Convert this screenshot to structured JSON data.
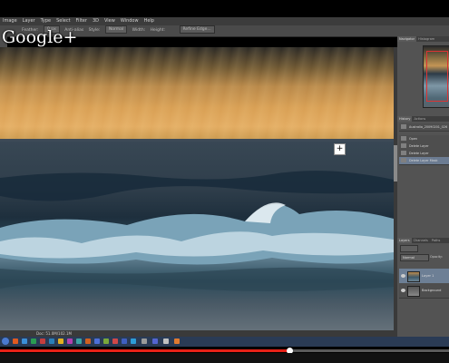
{
  "overlay": {
    "watermark": "Google+"
  },
  "menu": [
    "Image",
    "Layer",
    "Type",
    "Select",
    "Filter",
    "3D",
    "View",
    "Window",
    "Help"
  ],
  "options_bar": {
    "feather_label": "Feather:",
    "feather_value": "0 px",
    "antialias_label": "Anti-alias",
    "style_label": "Style:",
    "style_value": "Normal",
    "width_label": "Width:",
    "height_label": "Height:",
    "refine_button": "Refine Edge..."
  },
  "document": {
    "info": "Doc: 51.0M/102.1M"
  },
  "panels": {
    "top_tabs": [
      "Navigator",
      "Histogram"
    ],
    "history_tabs": [
      "History",
      "Actions"
    ],
    "history": [
      {
        "label": "Australia_20090201_026",
        "selected": false
      },
      {
        "label": "Open",
        "selected": false
      },
      {
        "label": "Delete Layer",
        "selected": false
      },
      {
        "label": "Delete Layer",
        "selected": false
      },
      {
        "label": "Delete Layer Mask",
        "selected": true
      }
    ],
    "layer_tabs": [
      "Layers",
      "Channels",
      "Paths"
    ],
    "blend_mode": "Normal",
    "opacity_label": "Opacity:",
    "layers": [
      {
        "name": "Layer 1",
        "selected": true
      },
      {
        "name": "Background",
        "selected": false
      }
    ]
  },
  "video": {
    "progress": 0.645
  },
  "colors": {
    "progress": "#e62117",
    "selection": "#6d7f95"
  }
}
